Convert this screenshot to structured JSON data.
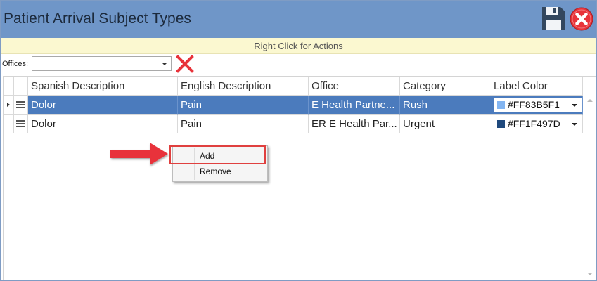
{
  "window": {
    "title": "Patient Arrival Subject Types"
  },
  "toolbar": {
    "save_icon": "floppy-disk-icon",
    "close_icon": "close-circle-icon",
    "close_color": "#e8333a"
  },
  "hint": {
    "text": "Right Click for Actions",
    "background": "#fbf8d0"
  },
  "filter": {
    "offices_label": "Offices:",
    "offices_value": "",
    "clear_icon": "red-x-icon",
    "clear_color": "#e8333a"
  },
  "grid": {
    "columns": [
      "Spanish Description",
      "English Description",
      "Office",
      "Category",
      "Label Color"
    ],
    "rows": [
      {
        "spanish": "Dolor",
        "english": "Pain",
        "office": "E Health Partne...",
        "category": "Rush",
        "color_label": "#FF83B5F1",
        "swatch": "#83B5F1",
        "selected": true
      },
      {
        "spanish": "Dolor",
        "english": "Pain",
        "office": "ER E Health Par...",
        "category": "Urgent",
        "color_label": "#FF1F497D",
        "swatch": "#1F497D",
        "selected": false
      }
    ],
    "selection_color": "#4b7bbd"
  },
  "context_menu": {
    "items": [
      "Add",
      "Remove"
    ],
    "highlighted": "Add",
    "highlight_color": "#e0403f"
  },
  "annotation": {
    "arrow_color": "#e8333a"
  }
}
